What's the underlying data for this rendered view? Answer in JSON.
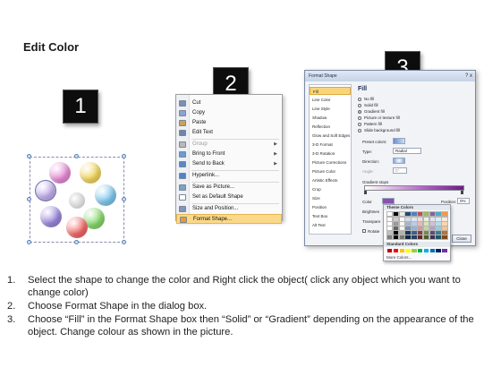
{
  "title": "Edit Color",
  "badges": [
    "1",
    "2",
    "3"
  ],
  "step1": {
    "petal_colors": [
      "#e68bd6",
      "#f3d65c",
      "#c6b2ee",
      "#7fc8ee",
      "#86d86b",
      "#f26767",
      "#9a86dc",
      "#5d92e0"
    ]
  },
  "context_menu": {
    "items": [
      {
        "label": "Cut",
        "icon": "scissors-icon",
        "color": "#7a8fb8"
      },
      {
        "label": "Copy",
        "icon": "copy-icon",
        "color": "#8aa4cf"
      },
      {
        "label": "Paste",
        "icon": "paste-icon",
        "color": "#c9a25a"
      },
      {
        "label": "Edit Text",
        "icon": "edit-text-icon",
        "color": "#6f85ad"
      },
      {
        "label": "Group",
        "icon": "group-icon",
        "color": "#b8b8b8",
        "disabled": true,
        "submenu": true
      },
      {
        "label": "Bring to Front",
        "icon": "bring-front-icon",
        "color": "#6b9bd4",
        "submenu": true
      },
      {
        "label": "Send to Back",
        "icon": "send-back-icon",
        "color": "#5a88c4",
        "submenu": true
      },
      {
        "label": "Hyperlink...",
        "icon": "hyperlink-icon",
        "color": "#4d86c9"
      },
      {
        "label": "Save as Picture...",
        "icon": "save-picture-icon",
        "color": "#7aa3c4"
      },
      {
        "label": "Set as Default Shape",
        "icon": "default-shape-icon",
        "color": "#ffffff"
      },
      {
        "label": "Size and Position...",
        "icon": "size-position-icon",
        "color": "#8096b8"
      },
      {
        "label": "Format Shape...",
        "icon": "format-shape-icon",
        "color": "#e39a3c"
      }
    ]
  },
  "dialog": {
    "title": "Format Shape",
    "close_x": "?  x",
    "categories": [
      "Fill",
      "Line Color",
      "Line Style",
      "Shadow",
      "Reflection",
      "Glow and Soft Edges",
      "3-D Format",
      "3-D Rotation",
      "Picture Corrections",
      "Picture Color",
      "Artistic Effects",
      "Crop",
      "Size",
      "Position",
      "Text Box",
      "Alt Text"
    ],
    "pane_heading": "Fill",
    "fill_options": [
      "No fill",
      "Solid fill",
      "Gradient fill",
      "Picture or texture fill",
      "Pattern fill",
      "Slide background fill"
    ],
    "selected_fill": 2,
    "preset_colors_label": "Preset colors:",
    "type_label": "Type:",
    "type_value": "Radial",
    "direction_label": "Direction:",
    "angle_label": "Angle:",
    "angle_value": "0°",
    "gradient_stops_label": "Gradient stops",
    "color_label": "Color",
    "position_label": "Position:",
    "position_value": "0%",
    "brightness_label": "Brightnes",
    "transparency_label": "Transpare",
    "rotate_label": "Rotate",
    "close_label": "Close"
  },
  "picker": {
    "theme_colors_label": "Theme Colors",
    "standard_colors_label": "Standard Colors",
    "more_colors_label": "More Colors...",
    "theme_top": [
      "#ffffff",
      "#000000",
      "#eeece1",
      "#1f497d",
      "#4f81bd",
      "#c0504d",
      "#9bbb59",
      "#8064a2",
      "#4bacc6",
      "#f79646"
    ],
    "standard": [
      "#c00000",
      "#ff0000",
      "#ffc000",
      "#ffff00",
      "#92d050",
      "#00b050",
      "#00b0f0",
      "#0070c0",
      "#002060",
      "#7030a0"
    ]
  },
  "instructions": [
    {
      "num": "1.",
      "text": "Select the shape to change the color and Right click the object( click any object which you want to change color)"
    },
    {
      "num": "2.",
      "text": "Choose Format Shape in the dialog box."
    },
    {
      "num": "3.",
      "text": "Choose “Fill” in the Format Shape box then “Solid” or “Gradient” depending on the appearance of the object. Change colour as shown in the picture."
    }
  ]
}
